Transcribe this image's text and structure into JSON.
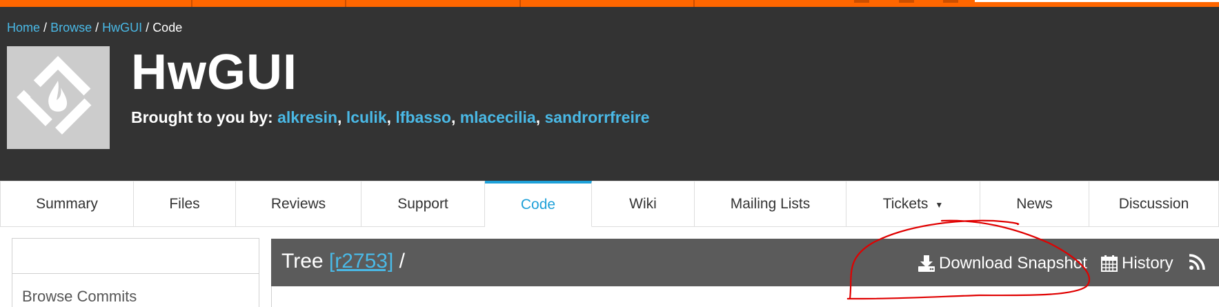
{
  "breadcrumb": {
    "home": "Home",
    "browse": "Browse",
    "project": "HwGUI",
    "current": "Code",
    "sep": "/"
  },
  "project": {
    "title": "HwGUI",
    "byline_label": "Brought to you by:",
    "authors": [
      "alkresin",
      "lculik",
      "lfbasso",
      "mlacecilia",
      "sandrorrfreire"
    ]
  },
  "tabs": [
    {
      "label": "Summary"
    },
    {
      "label": "Files"
    },
    {
      "label": "Reviews"
    },
    {
      "label": "Support"
    },
    {
      "label": "Code"
    },
    {
      "label": "Wiki"
    },
    {
      "label": "Mailing Lists"
    },
    {
      "label": "Tickets"
    },
    {
      "label": "News"
    },
    {
      "label": "Discussion"
    }
  ],
  "active_tab": "Code",
  "sidebar": {
    "browse_commits": "Browse Commits"
  },
  "tree": {
    "label": "Tree",
    "revision": "[r2753]",
    "path": "/",
    "download_snapshot": "Download Snapshot",
    "history": "History"
  },
  "icons": [
    "logo-icon",
    "download-icon",
    "calendar-icon",
    "rss-icon",
    "caret-down-icon"
  ],
  "colors": {
    "accent_orange": "#ff6600",
    "header_bg": "#333333",
    "link_blue": "#4ab9e6",
    "active_tab": "#1ea0d8",
    "tree_bar": "#5b5b5b",
    "annotation_red": "#e00000"
  }
}
